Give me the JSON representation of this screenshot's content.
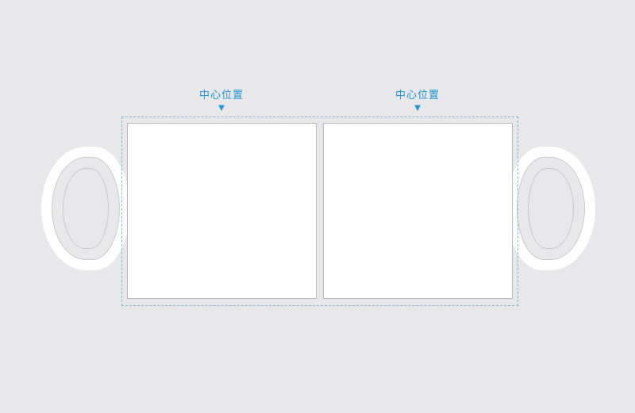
{
  "labels": {
    "left_center": "中心位置",
    "right_center": "中心位置"
  },
  "markers": {
    "triangle": "▼"
  }
}
